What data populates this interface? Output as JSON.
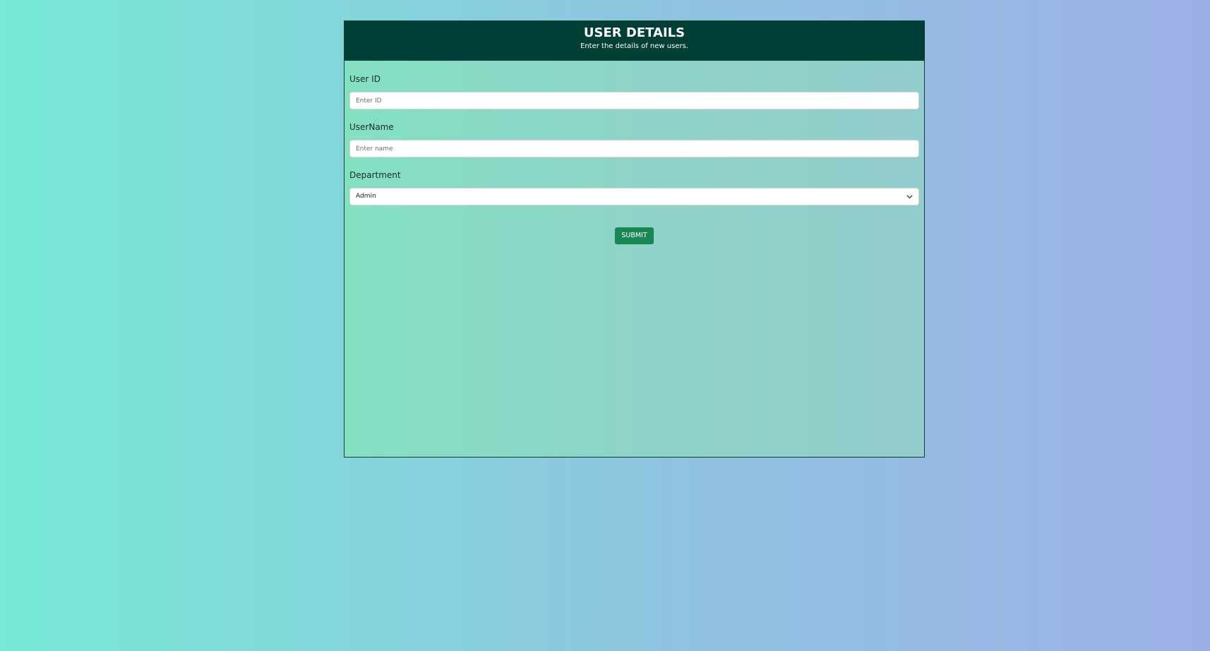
{
  "header": {
    "title": "USER DETAILS",
    "subtitle": "Enter the details of new users."
  },
  "form": {
    "user_id": {
      "label": "User ID",
      "placeholder": "Enter ID",
      "value": ""
    },
    "username": {
      "label": "UserName",
      "placeholder": "Enter name",
      "value": ""
    },
    "department": {
      "label": "Department",
      "selected": "Admin"
    },
    "submit_label": "SUBMIT"
  },
  "icons": {
    "dropdown": "chevron-down-icon"
  },
  "colors": {
    "header_bg": "#003f35",
    "submit_bg": "#198754",
    "page_gradient_start": "#77e9d6",
    "page_gradient_end": "#9db0e6"
  }
}
